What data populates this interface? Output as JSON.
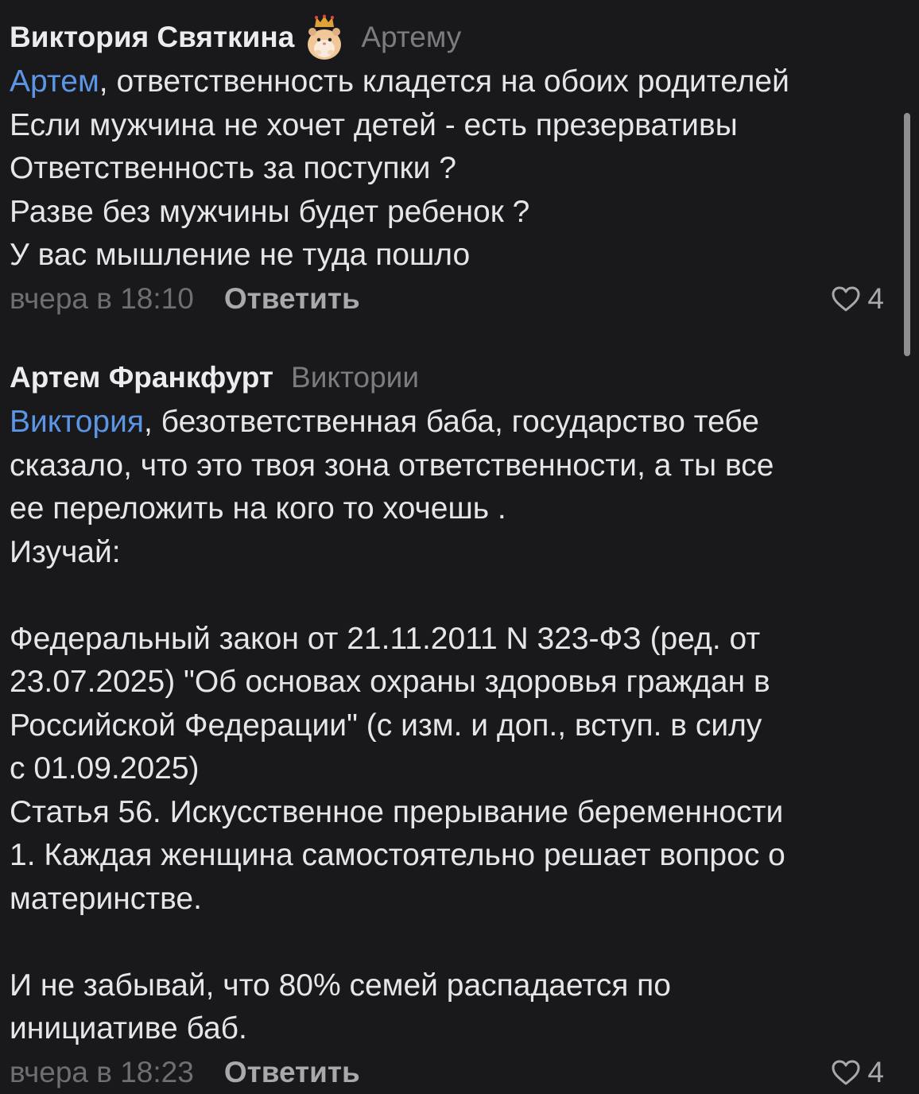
{
  "comments": [
    {
      "author": "Виктория Святкина",
      "reply_to": "Артему",
      "lines": [
        {
          "mention": "Артем",
          "text": ", ответственность кладется на обоих родителей"
        },
        {
          "text": "Если мужчина не хочет детей - есть презервативы"
        },
        {
          "text": "Ответственность за поступки ?"
        },
        {
          "text": "Разве без мужчины будет ребенок ?"
        },
        {
          "text": "У вас мышление не туда пошло"
        }
      ],
      "time": "вчера в 18:10",
      "reply_label": "Ответить",
      "likes": "4"
    },
    {
      "author": "Артем Франкфурт",
      "reply_to": "Виктории",
      "lines": [
        {
          "mention": "Виктория",
          "text": ", безответственная баба, государство тебе"
        },
        {
          "text": "сказало, что это твоя зона ответственности, а ты все"
        },
        {
          "text": "ее переложить на кого то хочешь ."
        },
        {
          "text": "Изучай:"
        },
        {
          "text": ""
        },
        {
          "text": "Федеральный закон от 21.11.2011 N 323-ФЗ (ред. от"
        },
        {
          "text": "23.07.2025) \"Об основах охраны здоровья граждан в"
        },
        {
          "text": "Российской Федерации\" (с изм. и доп., вступ. в силу"
        },
        {
          "text": "с 01.09.2025)"
        },
        {
          "text": "Статья 56. Искусственное прерывание беременности"
        },
        {
          "text": "1. Каждая женщина самостоятельно решает вопрос о"
        },
        {
          "text": "материнстве."
        },
        {
          "text": ""
        },
        {
          "text": "И не забывай, что 80% семей распадается по"
        },
        {
          "text": "инициативе баб."
        }
      ],
      "time": "вчера в 18:23",
      "reply_label": "Ответить",
      "likes": "4"
    }
  ],
  "colors": {
    "background": "#19191b",
    "text": "#e6e6e8",
    "mention": "#5b95e6",
    "muted": "#6e6e73"
  },
  "icons": [
    "hamster-crown-badge-icon",
    "heart-icon"
  ]
}
